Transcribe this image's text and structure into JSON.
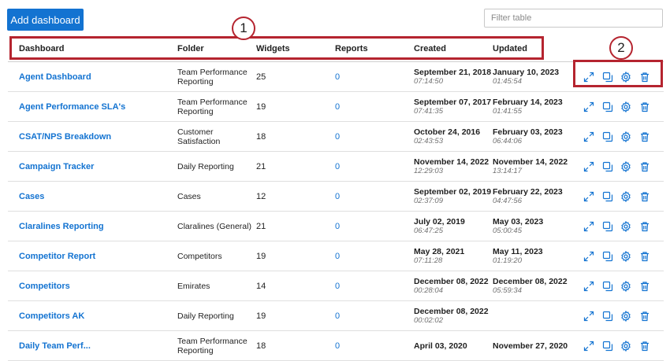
{
  "toolbar": {
    "add_label": "Add dashboard",
    "filter_placeholder": "Filter table"
  },
  "table": {
    "headers": {
      "dashboard": "Dashboard",
      "folder": "Folder",
      "widgets": "Widgets",
      "reports": "Reports",
      "created": "Created",
      "updated": "Updated"
    },
    "rows": [
      {
        "name": "Agent Dashboard",
        "folder": "Team Performance Reporting",
        "widgets": "25",
        "reports": "0",
        "created_date": "September 21, 2018",
        "created_time": "07:14:50",
        "updated_date": "January 10, 2023",
        "updated_time": "01:45:54"
      },
      {
        "name": "Agent Performance SLA's",
        "folder": "Team Performance Reporting",
        "widgets": "19",
        "reports": "0",
        "created_date": "September 07, 2017",
        "created_time": "07:41:35",
        "updated_date": "February 14, 2023",
        "updated_time": "01:41:55"
      },
      {
        "name": "CSAT/NPS Breakdown",
        "folder": "Customer Satisfaction",
        "widgets": "18",
        "reports": "0",
        "created_date": "October 24, 2016",
        "created_time": "02:43:53",
        "updated_date": "February 03, 2023",
        "updated_time": "06:44:06"
      },
      {
        "name": "Campaign Tracker",
        "folder": "Daily Reporting",
        "widgets": "21",
        "reports": "0",
        "created_date": "November 14, 2022",
        "created_time": "12:29:03",
        "updated_date": "November 14, 2022",
        "updated_time": "13:14:17"
      },
      {
        "name": "Cases",
        "folder": "Cases",
        "widgets": "12",
        "reports": "0",
        "created_date": "September 02, 2019",
        "created_time": "02:37:09",
        "updated_date": "February 22, 2023",
        "updated_time": "04:47:56"
      },
      {
        "name": "Claralines Reporting",
        "folder": "Claralines (General)",
        "widgets": "21",
        "reports": "0",
        "created_date": "July 02, 2019",
        "created_time": "06:47:25",
        "updated_date": "May 03, 2023",
        "updated_time": "05:00:45"
      },
      {
        "name": "Competitor Report",
        "folder": "Competitors",
        "widgets": "19",
        "reports": "0",
        "created_date": "May 28, 2021",
        "created_time": "07:11:28",
        "updated_date": "May 11, 2023",
        "updated_time": "01:19:20"
      },
      {
        "name": "Competitors",
        "folder": "Emirates",
        "widgets": "14",
        "reports": "0",
        "created_date": "December 08, 2022",
        "created_time": "00:28:04",
        "updated_date": "December 08, 2022",
        "updated_time": "05:59:34"
      },
      {
        "name": "Competitors AK",
        "folder": "Daily Reporting",
        "widgets": "19",
        "reports": "0",
        "created_date": "December 08, 2022",
        "created_time": "00:02:02",
        "updated_date": "",
        "updated_time": ""
      },
      {
        "name": "Daily Team Perf...",
        "folder": "Team Performance Reporting",
        "widgets": "18",
        "reports": "0",
        "created_date": "April 03, 2020",
        "created_time": "",
        "updated_date": "November 27, 2020",
        "updated_time": ""
      }
    ]
  },
  "callouts": {
    "one": "1",
    "two": "2"
  },
  "icons": {
    "expand": "expand-icon",
    "copy": "copy-icon",
    "settings": "gear-icon",
    "delete": "trash-icon"
  },
  "colors": {
    "accent": "#1373d1",
    "callout": "#b5242f"
  }
}
